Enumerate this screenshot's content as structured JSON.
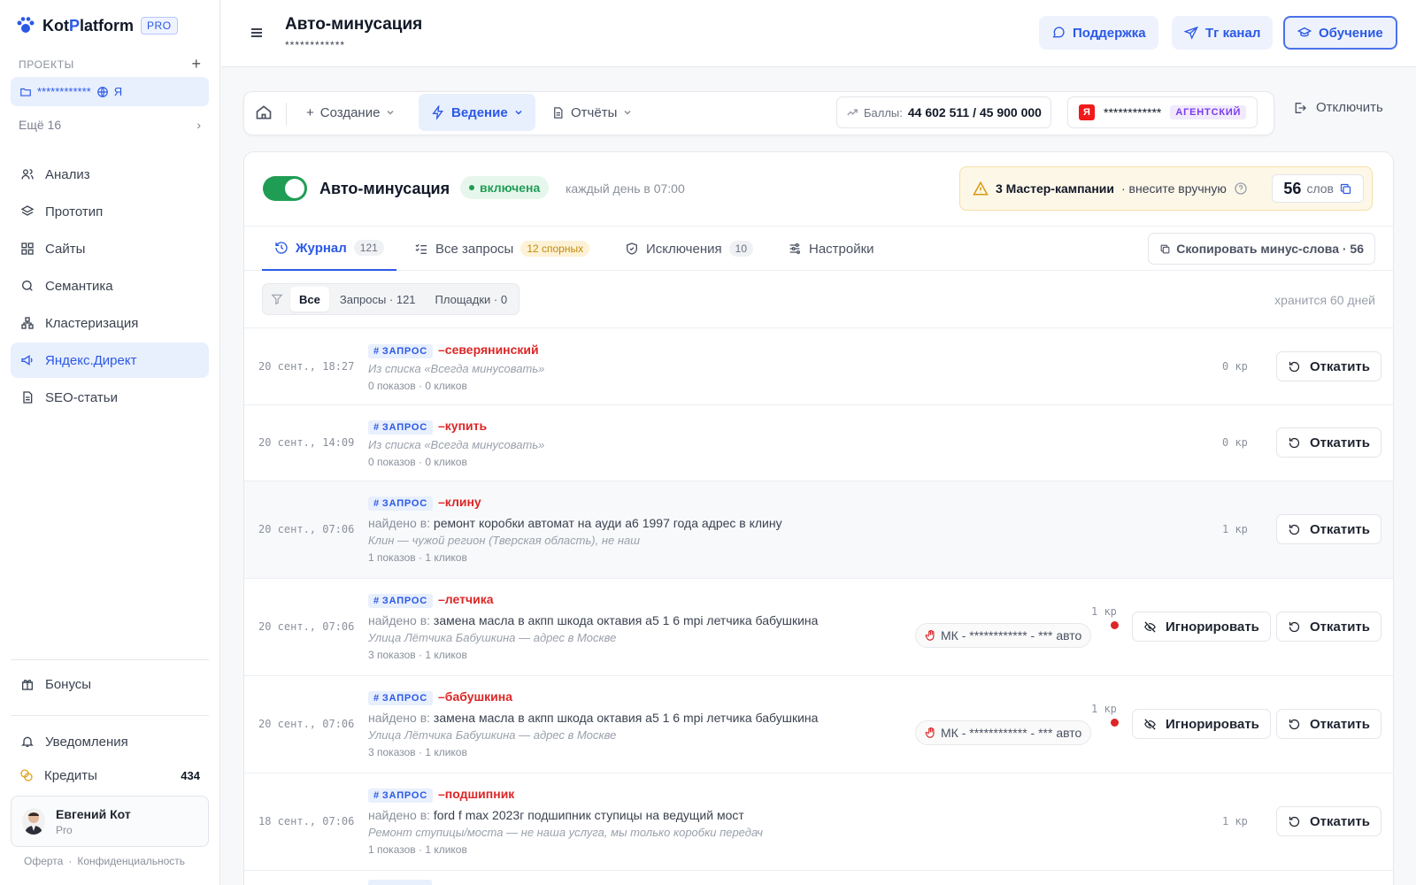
{
  "sidebar": {
    "logo_prefix": "Kot",
    "logo_accent": "P",
    "logo_suffix": "latform",
    "pro_badge": "PRO",
    "projects_label": "ПРОЕКТЫ",
    "project_name": "************",
    "project_engine": "Я",
    "more_label": "Ещё 16",
    "nav": [
      {
        "label": "Анализ",
        "icon": "users-icon"
      },
      {
        "label": "Прототип",
        "icon": "layers-icon"
      },
      {
        "label": "Сайты",
        "icon": "grid-icon"
      },
      {
        "label": "Семантика",
        "icon": "search-icon"
      },
      {
        "label": "Кластеризация",
        "icon": "cluster-icon"
      },
      {
        "label": "Яндекс.Директ",
        "icon": "megaphone-icon",
        "active": true
      },
      {
        "label": "SEO-статьи",
        "icon": "document-icon"
      }
    ],
    "bonus_label": "Бонусы",
    "notifications_label": "Уведомления",
    "credits_label": "Кредиты",
    "credits_value": "434",
    "user_name": "Евгений Кот",
    "user_plan": "Pro",
    "footer_offer": "Оферта",
    "footer_dot": "·",
    "footer_privacy": "Конфиденциальность"
  },
  "header": {
    "title": "Авто-минусация",
    "subtitle": "************",
    "support": "Поддержка",
    "tg": "Тг канал",
    "learning": "Обучение"
  },
  "toolbar": {
    "create": "Создание",
    "manage": "Ведение",
    "reports": "Отчёты",
    "score_label": "Баллы:",
    "score_value": "44 602 511 / 45 900 000",
    "account_name": "************",
    "account_type": "АГЕНТСКИЙ",
    "disconnect": "Отключить"
  },
  "card": {
    "title": "Авто-минусация",
    "status": "включена",
    "schedule": "каждый день в 07:00",
    "warn_bold": "3 Мастер-кампании",
    "warn_rest": "· внесите вручную",
    "words_count": "56",
    "words_label": "слов"
  },
  "tabs": {
    "journal": "Журнал",
    "journal_count": "121",
    "all": "Все запросы",
    "all_badge": "12 спорных",
    "exclusions": "Исключения",
    "exclusions_count": "10",
    "settings": "Настройки",
    "copy_btn": "Скопировать минус-слова · 56"
  },
  "filters": {
    "all": "Все",
    "queries": "Запросы · 121",
    "sites": "Площадки · 0",
    "retention": "хранится 60 дней"
  },
  "rows": [
    {
      "date": "20 сент., 18:27",
      "tag": "ЗАПРОС",
      "kw": "–северянинский",
      "found_label": "",
      "found": "",
      "note": "Из списка «Всегда минусовать»",
      "stats": "0 показов · 0 кликов",
      "cr": "0 кр",
      "rollback": "Откатить"
    },
    {
      "date": "20 сент., 14:09",
      "tag": "ЗАПРОС",
      "kw": "–купить",
      "found_label": "",
      "found": "",
      "note": "Из списка «Всегда минусовать»",
      "stats": "0 показов · 0 кликов",
      "cr": "0 кр",
      "rollback": "Откатить"
    },
    {
      "date": "20 сент., 07:06",
      "tag": "ЗАПРОС",
      "kw": "–клину",
      "found_label": "найдено в:",
      "found": "ремонт коробки автомат на ауди а6 1997 года адрес в клину",
      "note": "Клин — чужой регион (Тверская область), не наш",
      "stats": "1 показов · 1 кликов",
      "cr": "1 кр",
      "rollback": "Откатить"
    },
    {
      "date": "20 сент., 07:06",
      "tag": "ЗАПРОС",
      "kw": "–летчика",
      "found_label": "найдено в:",
      "found": "замена масла в акпп шкода октавия а5 1 6 mpi летчика бабушкина",
      "note": "Улица Лётчика Бабушкина — адрес в Москве",
      "stats": "3 показов · 1 кликов",
      "cr": "1 кр",
      "mk": "МК - ************ - *** авто",
      "ignore": "Игнорировать",
      "rollback": "Откатить"
    },
    {
      "date": "20 сент., 07:06",
      "tag": "ЗАПРОС",
      "kw": "–бабушкина",
      "found_label": "найдено в:",
      "found": "замена масла в акпп шкода октавия а5 1 6 mpi летчика бабушкина",
      "note": "Улица Лётчика Бабушкина — адрес в Москве",
      "stats": "3 показов · 1 кликов",
      "cr": "1 кр",
      "mk": "МК - ************ - *** авто",
      "ignore": "Игнорировать",
      "rollback": "Откатить"
    },
    {
      "date": "18 сент., 07:06",
      "tag": "ЗАПРОС",
      "kw": "–подшипник",
      "found_label": "найдено в:",
      "found": "ford f max 2023г подшипник ступицы на ведущий мост",
      "note": "Ремонт ступицы/моста — не наша услуга, мы только коробки передач",
      "stats": "1 показов · 1 кликов",
      "cr": "1 кр",
      "rollback": "Откатить"
    }
  ],
  "colors": {
    "accent": "#2b59e6",
    "success": "#1f9d55",
    "danger": "#dc2626",
    "warning_bg": "#fdf7e8"
  }
}
